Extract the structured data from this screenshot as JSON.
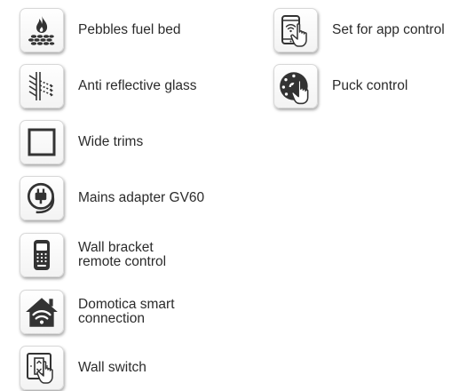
{
  "features_left": [
    {
      "label": "Pebbles fuel bed",
      "icon": "flame-pebbles-icon"
    },
    {
      "label": "Anti reflective glass",
      "icon": "glass-reflection-icon"
    },
    {
      "label": "Wide trims",
      "icon": "square-frame-icon"
    },
    {
      "label": "Mains adapter GV60",
      "icon": "power-plug-icon"
    },
    {
      "label": "Wall bracket\nremote control",
      "icon": "remote-control-icon"
    },
    {
      "label": "Domotica smart\nconnection",
      "icon": "smart-home-wifi-icon"
    },
    {
      "label": "Wall switch",
      "icon": "wall-switch-icon"
    }
  ],
  "features_right": [
    {
      "label": "Set for app control",
      "icon": "smartphone-app-icon"
    },
    {
      "label": "Puck control",
      "icon": "puck-dial-icon"
    }
  ]
}
